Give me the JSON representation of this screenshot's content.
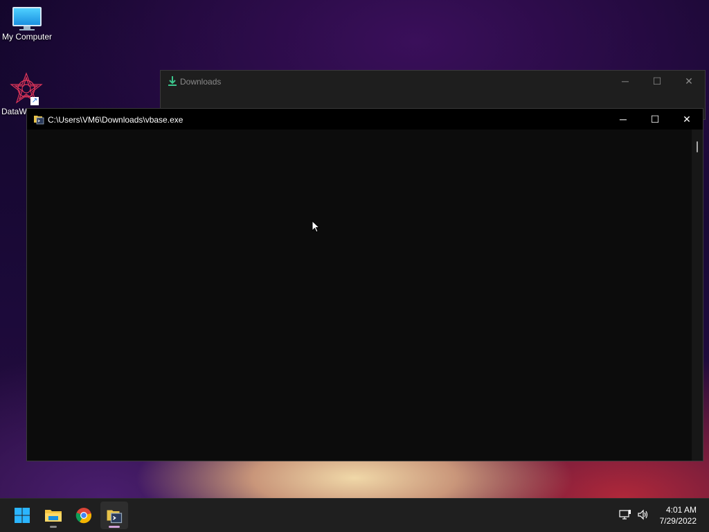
{
  "desktop": {
    "icons": [
      {
        "label": "My Computer",
        "icon": "monitor-icon"
      },
      {
        "label": "DataW",
        "icon": "datawin-star-icon"
      }
    ]
  },
  "explorer": {
    "title": "Downloads",
    "icon": "download-arrow-icon",
    "buttons": {
      "minimize": "─",
      "maximize": "☐",
      "close": "✕"
    }
  },
  "console": {
    "title": "C:\\Users\\VM6\\Downloads\\vbase.exe",
    "buttons": {
      "minimize": "─",
      "maximize": "☐",
      "close": "✕"
    },
    "content": ""
  },
  "taskbar": {
    "items": [
      {
        "name": "start",
        "icon": "windows-logo-icon"
      },
      {
        "name": "file-explorer",
        "icon": "folder-icon"
      },
      {
        "name": "chrome",
        "icon": "chrome-icon"
      },
      {
        "name": "vbase-console",
        "icon": "console-app-icon",
        "active": true
      }
    ],
    "clock": {
      "time": "4:01 AM",
      "date": "7/29/2022"
    }
  },
  "colors": {
    "accent": "#2bb5ff",
    "console_bg": "#0c0c0c",
    "taskbar_bg": "#1f1f1f"
  }
}
